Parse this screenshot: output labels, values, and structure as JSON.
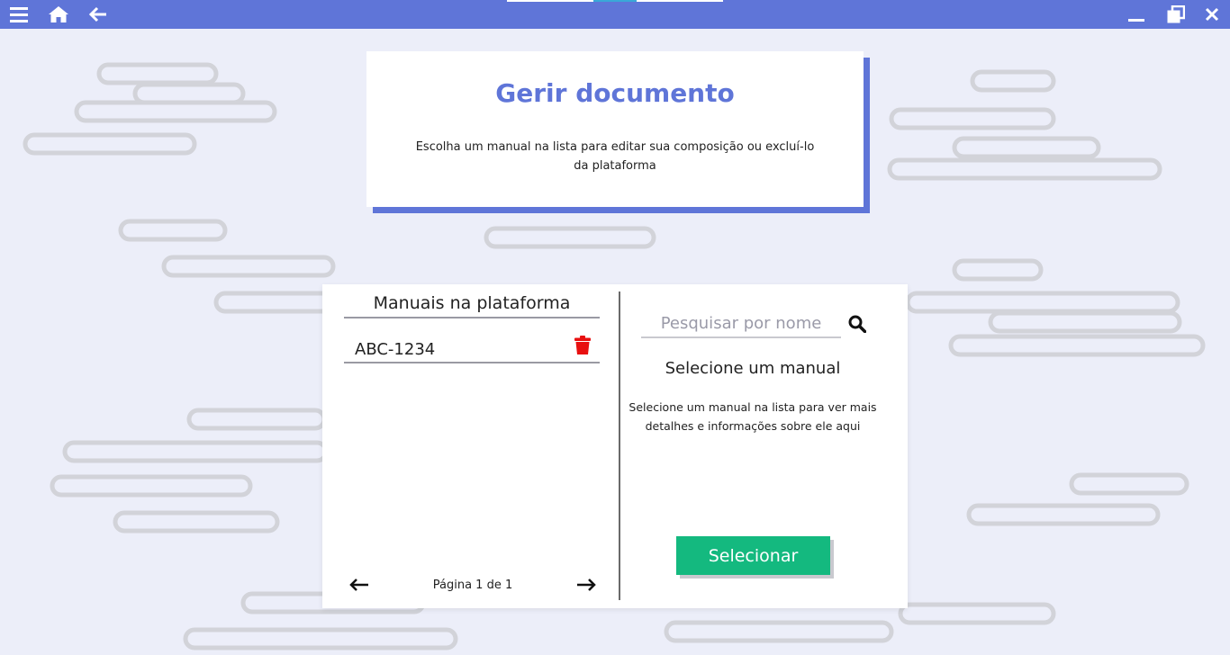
{
  "topbar": {
    "icons": {
      "menu": "menu-icon",
      "home": "home-icon",
      "back": "back-arrow-icon",
      "minimize": "minimize-icon",
      "restore": "restore-window-icon",
      "close": "close-icon"
    },
    "color": "#5f75d8"
  },
  "header": {
    "title": "Gerir documento",
    "subtitle": "Escolha um manual na lista para editar sua composição ou excluí-lo da plataforma"
  },
  "list": {
    "title": "Manuais na plataforma",
    "items": [
      {
        "label": "ABC-1234",
        "action_icon": "trash-icon"
      }
    ],
    "pagination": {
      "label": "Página 1 de 1",
      "prev_icon": "arrow-left-icon",
      "next_icon": "arrow-right-icon"
    }
  },
  "details": {
    "search_placeholder": "Pesquisar por nome",
    "search_value": "",
    "title": "Selecione um manual",
    "description": "Selecione um manual na lista para ver mais detalhes e informações sobre ele aqui",
    "select_label": "Selecionar"
  },
  "colors": {
    "accent": "#5f75d8",
    "select_button": "#14b97f",
    "delete_icon": "#e81010"
  }
}
